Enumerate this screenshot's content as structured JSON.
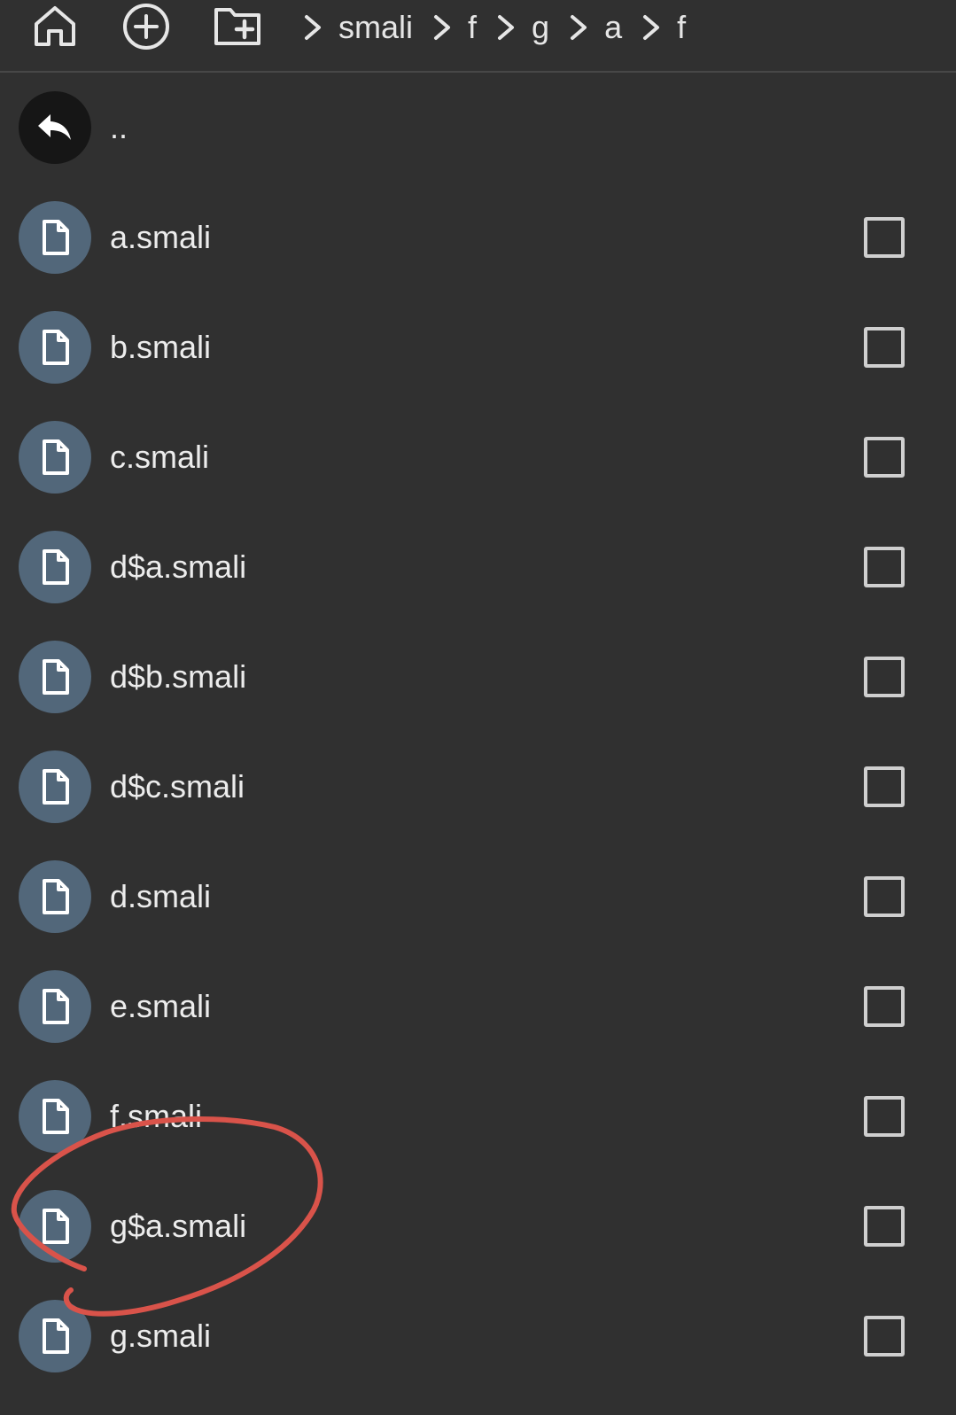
{
  "toolbar": {
    "icons": [
      "home-icon",
      "add-circle-icon",
      "new-folder-icon"
    ]
  },
  "breadcrumb": {
    "items": [
      "smali",
      "f",
      "g",
      "a",
      "f"
    ]
  },
  "list": {
    "parent_label": "..",
    "files": [
      "a.smali",
      "b.smali",
      "c.smali",
      "d$a.smali",
      "d$b.smali",
      "d$c.smali",
      "d.smali",
      "e.smali",
      "f.smali",
      "g$a.smali",
      "g.smali"
    ]
  },
  "colors": {
    "background": "#303030",
    "file_avatar": "#52677a",
    "parent_avatar": "#161616",
    "annotation_circle": "#d9534a"
  }
}
